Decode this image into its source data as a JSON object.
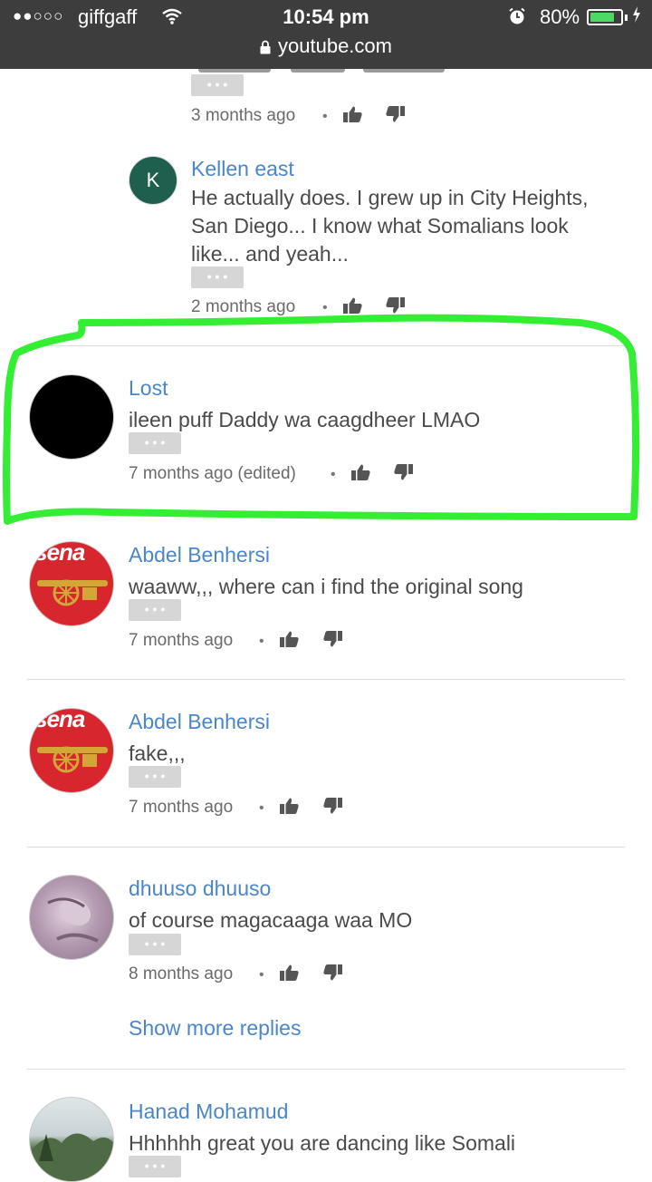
{
  "status_bar": {
    "signal": "●●○○○",
    "carrier": "giffgaff",
    "time": "10:54 pm",
    "battery": "80%",
    "battery_level": 0.8,
    "url": "youtube.com"
  },
  "comments": [
    {
      "meta": "3 months ago"
    },
    {
      "author": "Kellen east",
      "avatar_letter": "K",
      "avatar_color": "#1e5f4e",
      "lines": [
        "He actually does. I grew up in City Heights,",
        "San Diego... I know what Somalians look",
        "like... and yeah..."
      ],
      "meta": "2 months ago"
    },
    {
      "author": "Lost",
      "lines": [
        "ileen puff Daddy wa caagdheer LMAO"
      ],
      "meta": "7 months ago (edited)"
    },
    {
      "author": "Abdel Benhersi",
      "avatar_text": "rsena",
      "lines": [
        "waaww,,, where can i find the original song"
      ],
      "meta": "7 months ago"
    },
    {
      "author": "Abdel Benhersi",
      "avatar_text": "rsena",
      "lines": [
        "fake,,,"
      ],
      "meta": "7 months ago"
    },
    {
      "author": "dhuuso dhuuso",
      "lines": [
        "of course magacaaga waa MO"
      ],
      "meta": "8 months ago"
    },
    {
      "author": "Hanad Mohamud",
      "lines": [
        "Hhhhhh great you are dancing like Somali"
      ]
    }
  ],
  "show_more_replies": "Show more replies",
  "colors": {
    "link": "#4a86c8",
    "highlight": "#33ee33",
    "status_bg": "#3d3d3d"
  }
}
